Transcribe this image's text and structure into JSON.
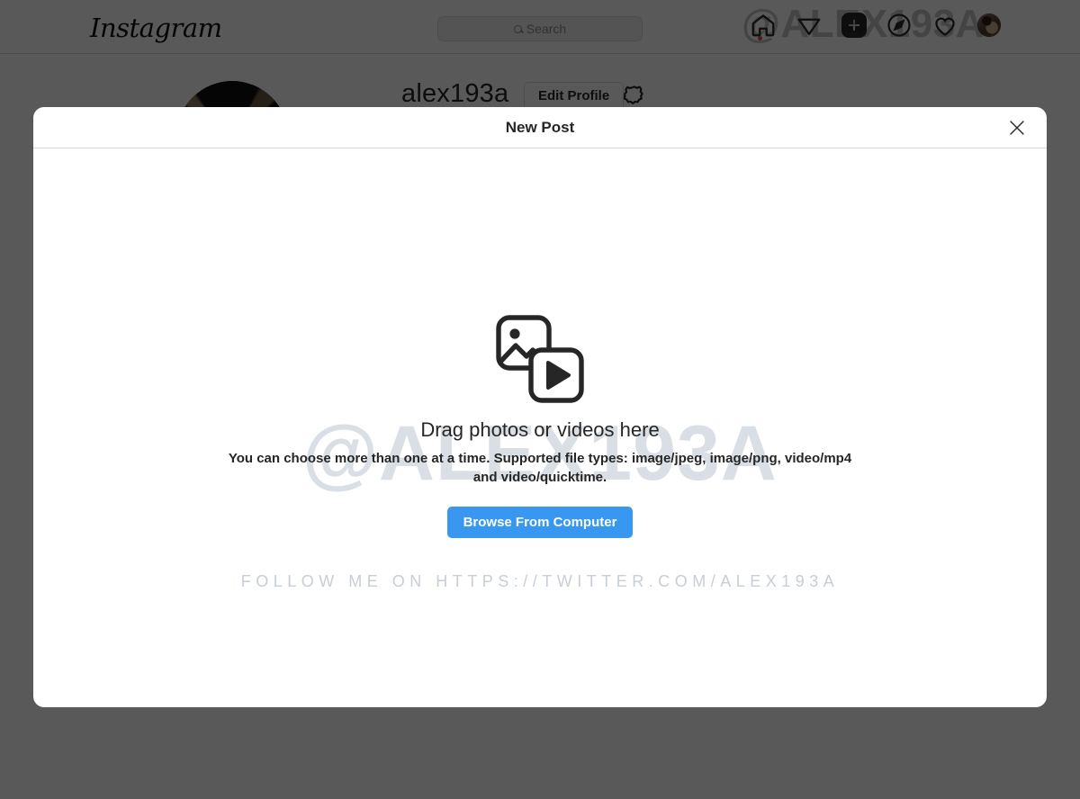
{
  "app": {
    "brand": "Instagram",
    "watermark": "@ALEX193A"
  },
  "navbar": {
    "search": {
      "placeholder": "Search",
      "value": "",
      "icon": "search-icon"
    },
    "icons": [
      {
        "name": "home-icon",
        "label": "Home",
        "has_badge": true
      },
      {
        "name": "messenger-icon",
        "label": "Messages",
        "has_badge": false
      },
      {
        "name": "new-post-icon",
        "label": "New post",
        "has_badge": false
      },
      {
        "name": "explore-icon",
        "label": "Explore",
        "has_badge": false
      },
      {
        "name": "heart-icon",
        "label": "Notifications",
        "has_badge": false
      },
      {
        "name": "avatar-icon",
        "label": "Profile",
        "has_badge": false
      }
    ]
  },
  "profile": {
    "username": "alex193a",
    "edit_button": "Edit Profile",
    "settings_icon": "gear-icon"
  },
  "modal": {
    "title": "New Post",
    "close_label": "✕",
    "drop_icon": "photo-video-icon",
    "drop_title": "Drag photos or videos here",
    "drop_subtitle": "You can choose more than one at a time. Supported file types: image/jpeg, image/png, video/mp4 and video/quicktime.",
    "browse_button": "Browse From Computer",
    "follow_text": "FOLLOW ME ON HTTPS://TWITTER.COM/ALEX193A"
  },
  "colors": {
    "accent_blue": "#3897f0",
    "text_primary": "#262626",
    "text_muted": "#8e8e8e",
    "border": "#dbdbdb",
    "watermark": "#d9dfe5",
    "follow_text": "#c7ced6",
    "badge_red": "#ed4956",
    "scrim": "rgba(0,0,0,0.65)"
  }
}
